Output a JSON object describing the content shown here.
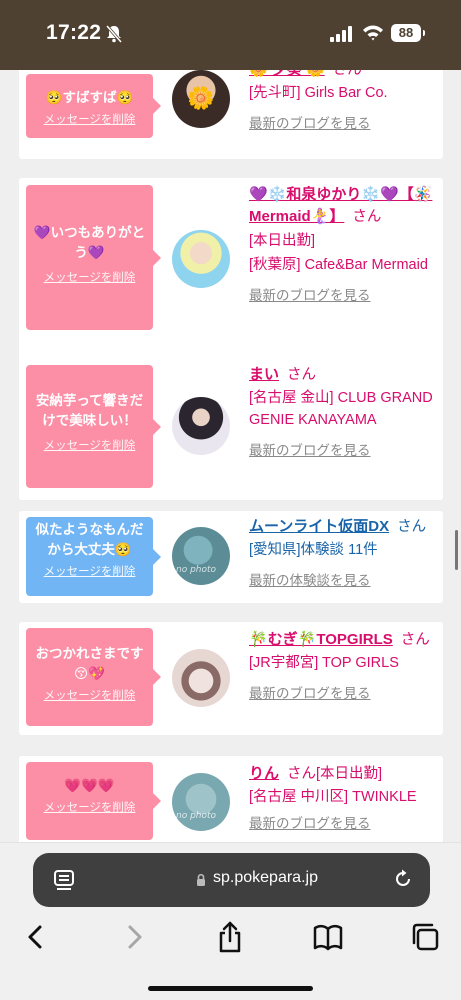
{
  "status_bar": {
    "time": "17:22",
    "battery": "88",
    "bell_icon": "bell-slash-icon",
    "signal_icon": "signal-icon",
    "wifi_icon": "wifi-icon"
  },
  "cards": [
    {
      "message": "🥺すばすば🥺",
      "delete_label": "メッセージを削除",
      "bubble_color": "#fc8ea5",
      "name": "🌼 夕葵 🌼",
      "san": "さん",
      "shop_lines": [
        "[先斗町] Girls Bar Co."
      ],
      "link": "最新のブログを見る",
      "avatar_emoji": "🌼"
    },
    {
      "message": "💜いつもありがとう💜",
      "delete_label": "メッセージを削除",
      "bubble_color": "#fc8ea5",
      "name": "💜❄️和泉ゆかり❄️💜【🪅Mermaid🧜‍♀️】",
      "san": "さん",
      "shop_lines": [
        "[本日出勤]",
        "[秋葉原] Cafe&Bar Mermaid"
      ],
      "link": "最新のブログを見る"
    },
    {
      "message": "安納芋って響きだけで美味しい！",
      "delete_label": "メッセージを削除",
      "bubble_color": "#fc8ea5",
      "name": "まい",
      "san": "さん",
      "shop_lines": [
        "[名古屋 金山] CLUB GRAND GENIE KANAYAMA"
      ],
      "link": "最新のブログを見る"
    },
    {
      "message": "似たようなもんだから大丈夫🥺",
      "delete_label": "メッセージを削除",
      "bubble_color": "#72b5f5",
      "name": "ムーンライト仮面DX",
      "san": "さん",
      "shop_lines": [
        "[愛知県]体験談 11件"
      ],
      "link": "最新の体験談を見る",
      "avatar_label": "no photo"
    },
    {
      "message": "おつかれさまです😚💖",
      "delete_label": "メッセージを削除",
      "bubble_color": "#fc8ea5",
      "name": "🎋むぎ🎋TOPGIRLS",
      "san": "さん",
      "shop_lines": [
        "[JR宇都宮] TOP GIRLS"
      ],
      "link": "最新のブログを見る"
    },
    {
      "message": "💗💗💗",
      "delete_label": "メッセージを削除",
      "bubble_color": "#fc8ea5",
      "name": "りん",
      "san": "さん",
      "tail": "[本日出勤]",
      "shop_lines": [
        "[名古屋 中川区] TWINKLE"
      ],
      "link": "最新のブログを見る",
      "avatar_label": "no photo"
    }
  ],
  "browser": {
    "url": "sp.pokepara.jp",
    "icons": {
      "tabs_overview": "page-menu-icon",
      "lock": "lock-icon",
      "reload": "reload-icon",
      "back": "chevron-left-icon",
      "forward": "chevron-right-icon",
      "share": "share-icon",
      "bookmarks": "book-icon",
      "tabs": "tabs-icon"
    }
  }
}
